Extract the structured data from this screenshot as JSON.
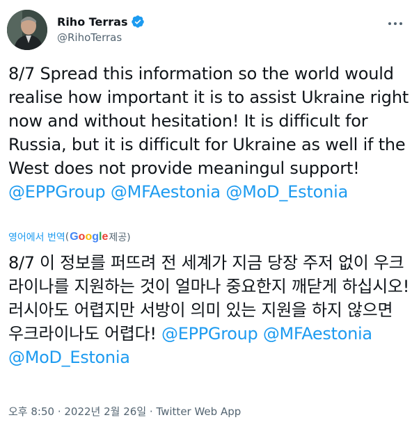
{
  "author": {
    "display_name": "Riho Terras",
    "handle": "@RihoTerras",
    "verified_icon": "verified-badge-icon"
  },
  "tweet": {
    "text": "8/7 Spread this information so the world would realise how important it is to assist Ukraine right now and without hesitation! It is difficult for Russia, but it is difficult for Ukraine as well if the West does not provide meaningul support! ",
    "mentions": [
      "@EPPGroup",
      "@MFAestonia",
      "@MoD_Estonia"
    ]
  },
  "translation": {
    "label": "영어에서 번역",
    "paren_open": "(",
    "provider": "Google",
    "provided_by": " 제공)",
    "text": "8/7 이 정보를 퍼뜨려 전 세계가 지금 당장 주저 없이 우크라이나를 지원하는 것이 얼마나 중요한지 깨닫게 하십시오! 러시아도 어렵지만 서방이 의미 있는 지원을 하지 않으면 우크라이나도 어렵다! ",
    "mentions": [
      "@EPPGroup",
      "@MFAestonia",
      "@MoD_Estonia"
    ]
  },
  "meta": {
    "time": "오후 8:50",
    "separator": " · ",
    "date": "2022년 2월 26일",
    "source": "Twitter Web App"
  },
  "colors": {
    "accent": "#1d9bf0",
    "secondary_text": "#536471",
    "google_blue": "#4285f4",
    "google_red": "#ea4335",
    "google_yellow": "#fbbc05",
    "google_green": "#34a853"
  }
}
